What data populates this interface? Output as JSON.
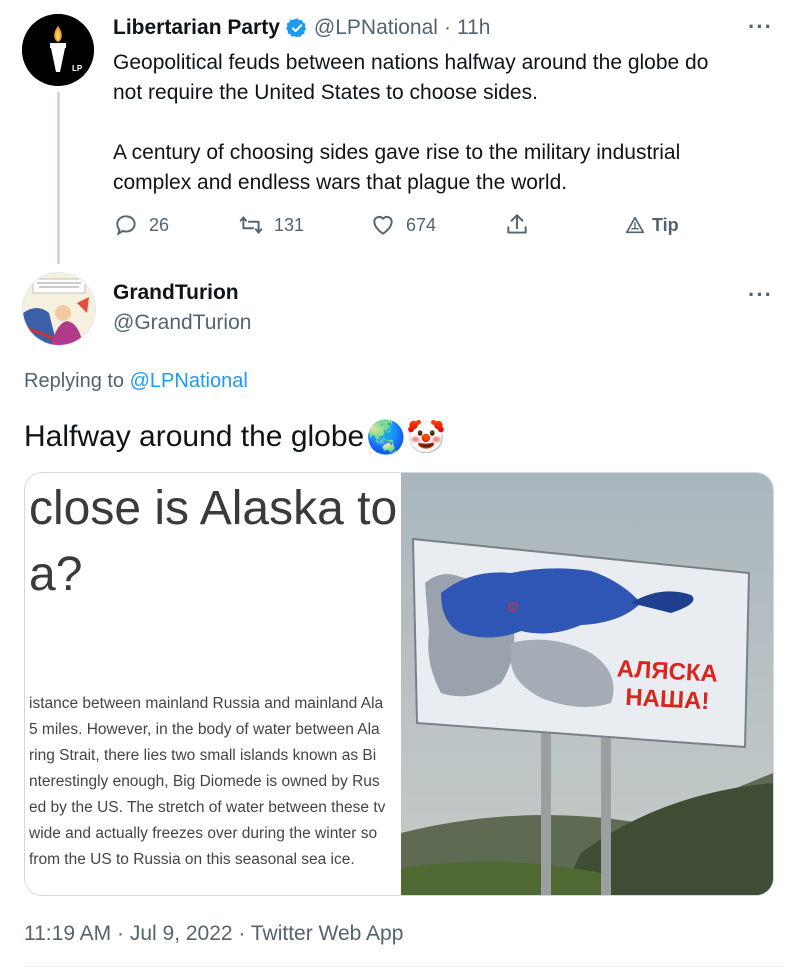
{
  "tweet1": {
    "author": "Libertarian Party",
    "handle": "@LPNational",
    "time": "11h",
    "avatar_text": "LP",
    "paragraph1_line1": "Geopolitical feuds between nations halfway around the globe do",
    "paragraph1_line2": "not require the United States to choose sides.",
    "paragraph2_line1": "A century of choosing sides gave rise to the military industrial",
    "paragraph2_line2": "complex and endless wars that plague the world.",
    "replies": "26",
    "retweets": "131",
    "likes": "674",
    "tip_label": "Tip",
    "verified_color": "#1d9bf0"
  },
  "tweet2": {
    "author": "GrandTurion",
    "handle": "@GrandTurion",
    "replying_prefix": "Replying to",
    "replying_handle": "@LPNational",
    "text": "Halfway around the globe",
    "emojis": "🌏🤡",
    "article": {
      "heading_line1": "close is Alaska to",
      "heading_line2": "a?",
      "lines": [
        "istance between mainland Russia and mainland Ala",
        "5 miles. However, in the body of water between Ala",
        "ring Strait, there lies two small islands known as Bi",
        "nterestingly enough, Big Diomede is owned by Rus",
        "ed by the US. The stretch of water between these tv",
        "wide and actually freezes over during the winter so",
        " from the US to Russia on this seasonal sea ice."
      ]
    },
    "billboard_line1": "АЛЯСКА",
    "billboard_line2": "НАША!",
    "footer": "11:19 AM · Jul 9, 2022 · Twitter Web App"
  },
  "more_icon": "···",
  "accent_color": "#1d9bf0"
}
